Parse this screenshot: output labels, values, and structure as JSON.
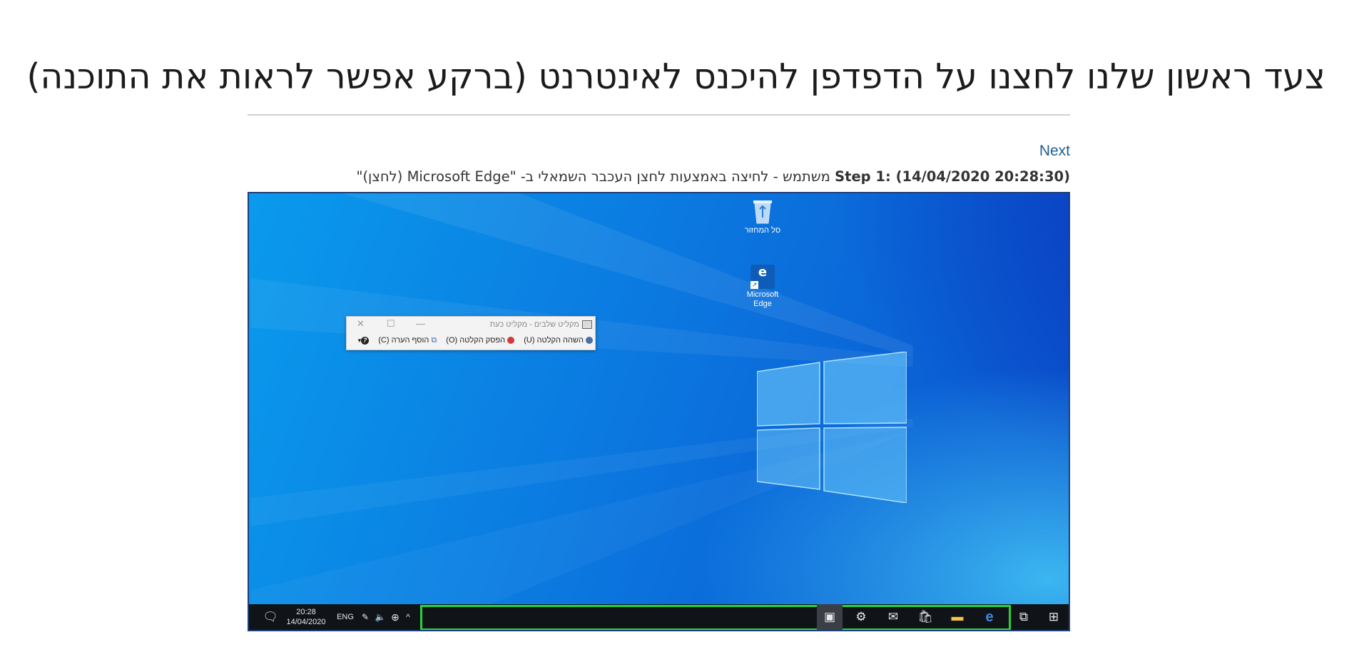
{
  "page": {
    "heading": "צעד ראשון שלנו לחצנו על הדפדפן להיכנס לאינטרנט (ברקע אפשר לראות את התוכנה)",
    "next_label": "Next",
    "step_bold": "Step 1: (14/04/2020 20:28:30)",
    "step_text": " משתמש - לחיצה באמצעות לחצן העכבר השמאלי ב- \"Microsoft Edge (לחצן)\""
  },
  "desktop": {
    "recycle_bin_label": "סל המחזור",
    "edge_label": "Microsoft Edge",
    "edge_letter": "e",
    "shortcut_arrow": "↗"
  },
  "recorder_window": {
    "title": "מקליט שלבים - מקליט כעת",
    "minimize": "—",
    "maximize": "☐",
    "close": "✕",
    "pause_label": "השהה הקלטה (U)",
    "stop_label": "הפסק הקלטה (O)",
    "comment_label": "הוסף הערה (C)",
    "help_glyph": "?",
    "dropdown_glyph": "▾"
  },
  "taskbar": {
    "notifications_icon": "🗨",
    "time": "20:28",
    "date": "14/04/2020",
    "language": "ENG",
    "pen_icon": "✎",
    "volume_icon": "🔈",
    "network_icon": "⊕",
    "chevron_icon": "^",
    "recorder_icon": "▣",
    "settings_icon": "⚙",
    "mail_icon": "✉",
    "store_icon": "🛍",
    "explorer_icon": "▬",
    "edge_icon": "e",
    "taskview_icon": "⧉",
    "start_icon": "⊞",
    "highlight_color": "#27d23c"
  }
}
